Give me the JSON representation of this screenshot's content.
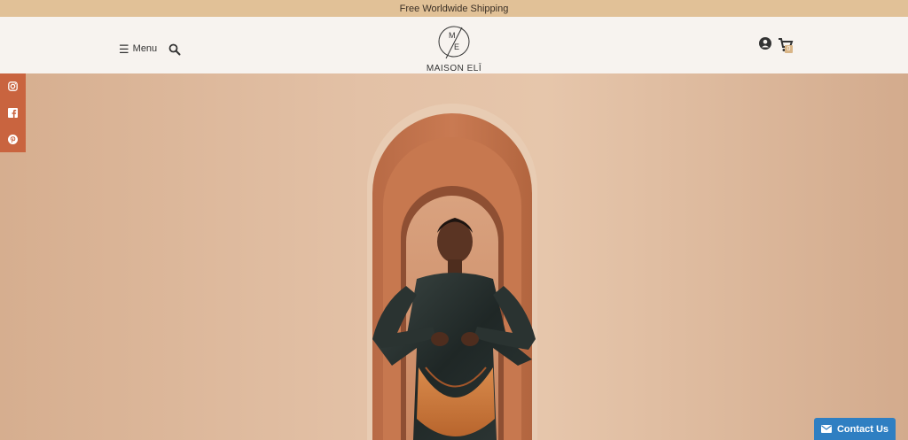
{
  "announcement": {
    "text": "Free Worldwide Shipping"
  },
  "header": {
    "menu_label": "Menu",
    "logo": {
      "monogram_top": "M",
      "monogram_bottom": "E",
      "wordmark": "MAISON ELĪ"
    },
    "cart_count": "0"
  },
  "hero": {
    "image_alt": "Model holding orange crescent handbag in arched doorway"
  },
  "social": {
    "icons": [
      "instagram-icon",
      "facebook-icon",
      "pinterest-icon"
    ]
  },
  "contact": {
    "label": "Contact Us"
  },
  "colors": {
    "announcement_bg": "#e1c197",
    "header_bg": "#f7f3ef",
    "social_bg": "#c9643f",
    "contact_bg": "#2f7fc2",
    "cart_badge_bg": "#d9b587"
  }
}
